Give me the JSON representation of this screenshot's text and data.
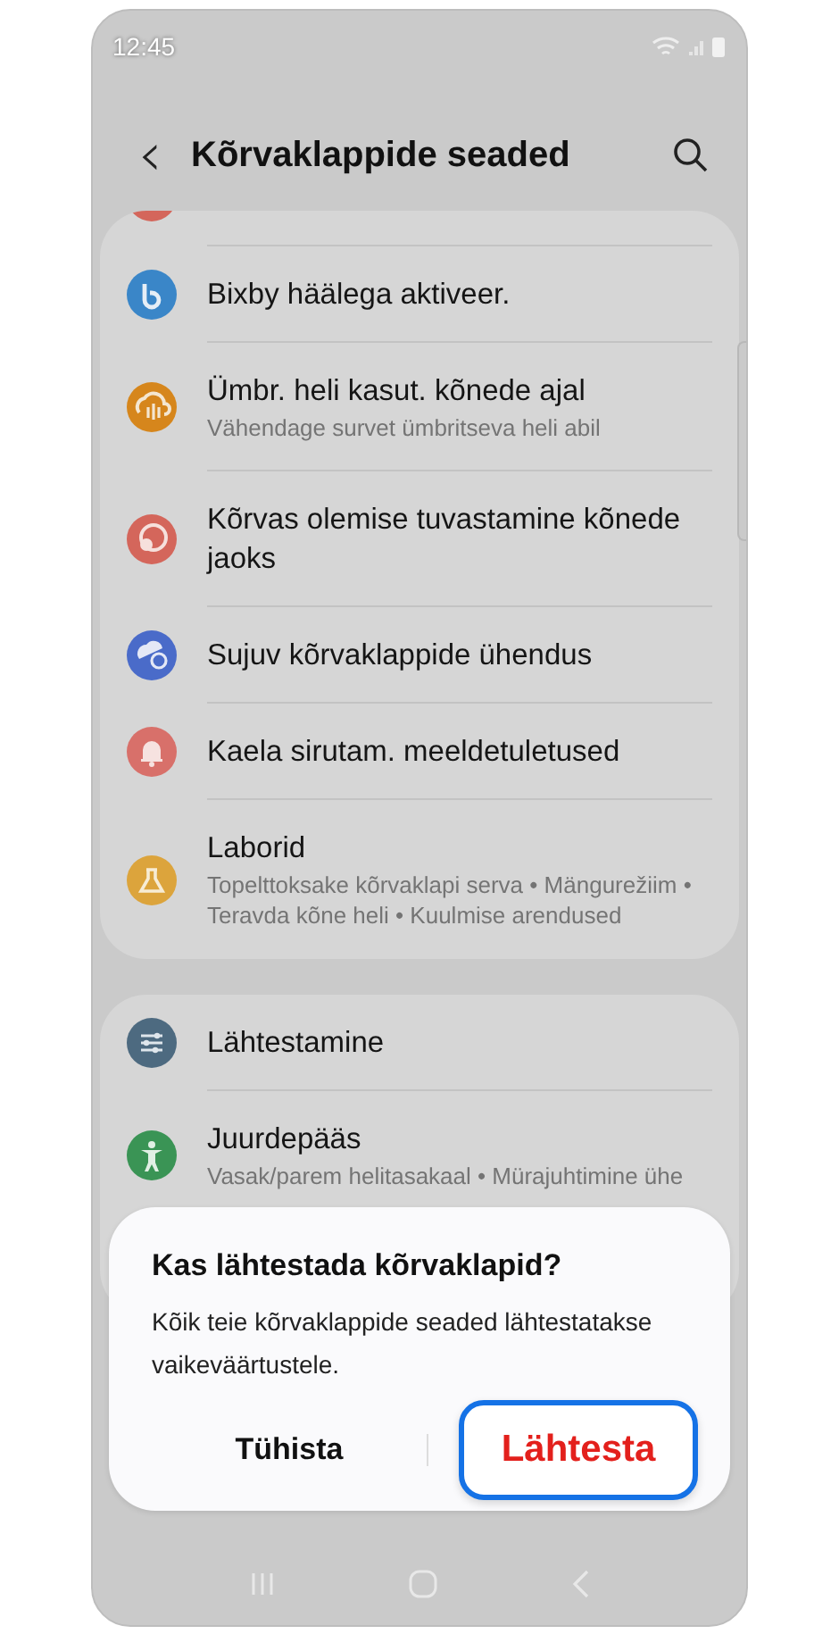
{
  "status_bar": {
    "time": "12:45"
  },
  "header": {
    "back": "‹",
    "title": "Kõrvaklappide seaded"
  },
  "cards": [
    {
      "items": [
        {
          "title": "Bixby häälega aktiveer.",
          "color": "#3a86c8"
        },
        {
          "title": "Ümbr. heli kasut. kõnede ajal",
          "subtitle": "Vähendage survet ümbritseva heli abil",
          "color": "#d6861c"
        },
        {
          "title": "Kõrvas olemise tuvastamine kõnede jaoks",
          "color": "#d4665b"
        },
        {
          "title": "Sujuv kõrvaklappide ühendus",
          "color": "#4a6bc9"
        },
        {
          "title": "Kaela sirutam. meeldetuletused",
          "color": "#d8706a"
        },
        {
          "title": "Laborid",
          "subtitle": "Topelttoksake kõrvaklapi serva  •  Mängurežiim  •  Teravda kõne heli  •  Kuulmise arendused",
          "color": "#dca43c"
        }
      ]
    },
    {
      "items": [
        {
          "title": "Lähtestamine",
          "color": "#4d6a80"
        },
        {
          "title": "Juurdepääs",
          "subtitle": "Vasak/parem helitasakaal  •  Mürajuhtimine ühe",
          "color": "#3a9455"
        }
      ]
    }
  ],
  "dialog": {
    "title": "Kas lähtestada kõrvaklapid?",
    "message": "Kõik teie kõrvaklappide seaded lähtestatakse vaikeväärtustele.",
    "buttons": [
      {
        "label": "Tühista",
        "selected": false
      },
      {
        "label": "Lähtesta",
        "selected": true
      }
    ]
  }
}
